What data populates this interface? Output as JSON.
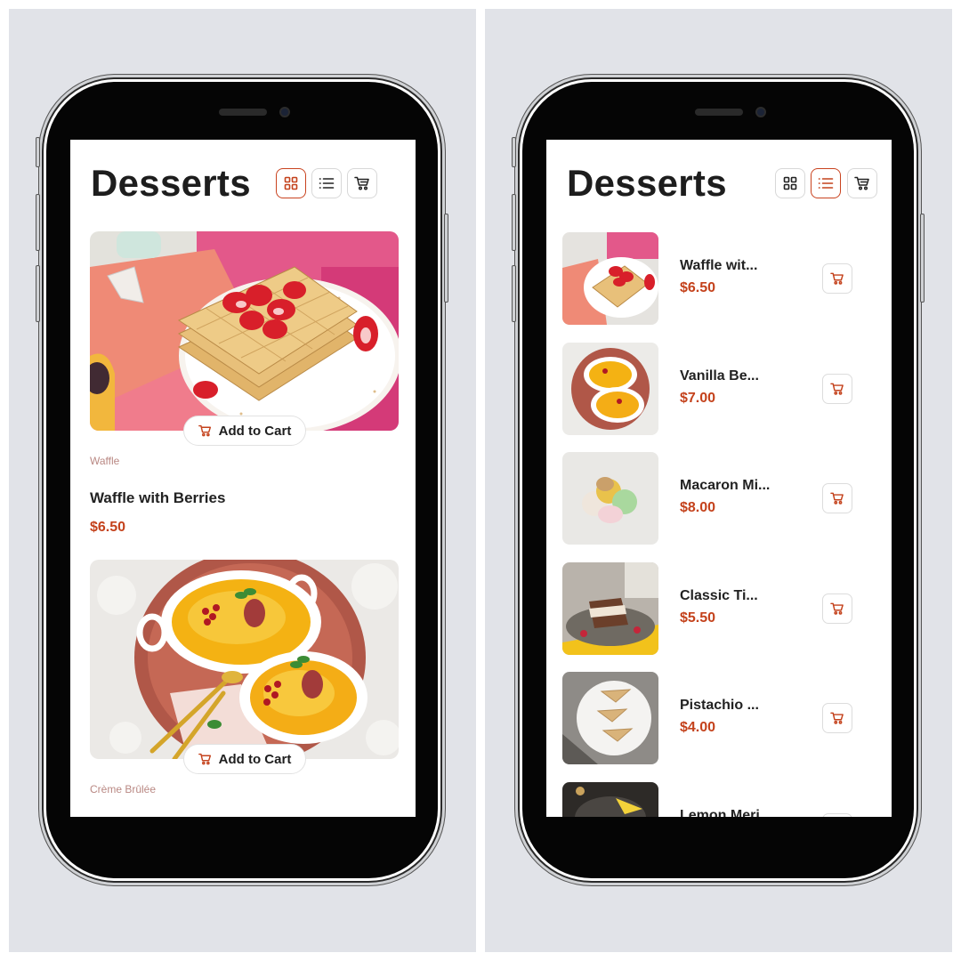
{
  "colors": {
    "accent": "#c4421c",
    "background_panel": "#e1e3e8",
    "category_text": "#b98883"
  },
  "grid_view": {
    "title": "Desserts",
    "toolbar": {
      "grid_icon": "grid-view-icon",
      "list_icon": "list-view-icon",
      "cart_icon": "cart-icon",
      "active": "grid"
    },
    "items": [
      {
        "category": "Waffle",
        "name": "Waffle with Berries",
        "price": "$6.50",
        "add_label": "Add to Cart",
        "image": "waffle-with-berries"
      },
      {
        "category": "Crème Brûlée",
        "name": "",
        "price": "",
        "add_label": "Add to Cart",
        "image": "creme-brulee"
      }
    ]
  },
  "list_view": {
    "title": "Desserts",
    "toolbar": {
      "active": "list"
    },
    "items": [
      {
        "name": "Waffle wit...",
        "price": "$6.50",
        "image": "waffle"
      },
      {
        "name": "Vanilla Be...",
        "price": "$7.00",
        "image": "vanilla-bean"
      },
      {
        "name": "Macaron Mi...",
        "price": "$8.00",
        "image": "macarons"
      },
      {
        "name": "Classic Ti...",
        "price": "$5.50",
        "image": "tiramisu"
      },
      {
        "name": "Pistachio ...",
        "price": "$4.00",
        "image": "pistachio"
      },
      {
        "name": "Lemon Meri...",
        "price": "",
        "image": "lemon-meringue"
      }
    ]
  }
}
